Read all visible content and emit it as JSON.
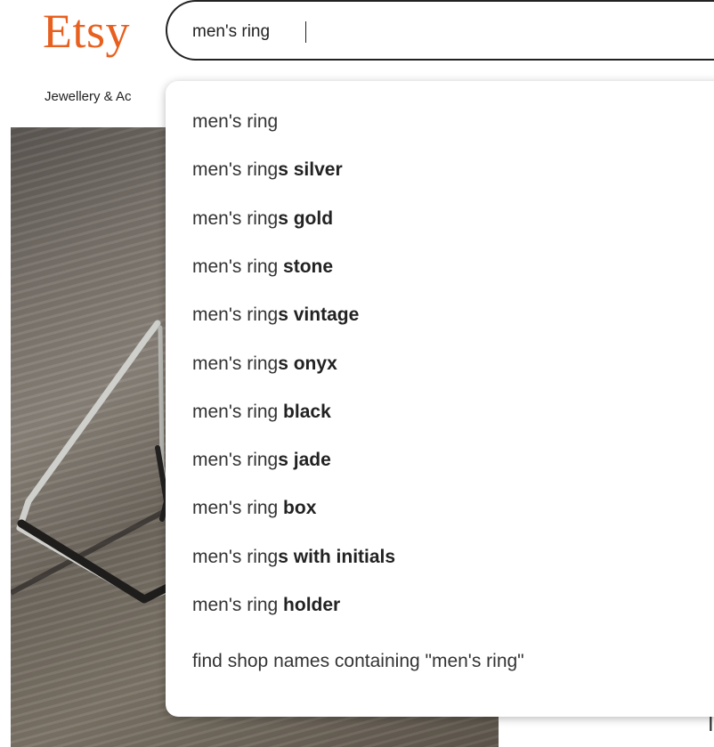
{
  "brand": {
    "logo_text": "Etsy",
    "logo_color": "#e8601f"
  },
  "search": {
    "value": "men's ring"
  },
  "category_nav": {
    "first_item_visible": "Jewellery & Ac"
  },
  "suggestions": [
    {
      "base": "men's ring",
      "suffix": ""
    },
    {
      "base": "men's ring",
      "suffix": "s silver"
    },
    {
      "base": "men's ring",
      "suffix": "s gold"
    },
    {
      "base": "men's ring",
      "suffix": " stone"
    },
    {
      "base": "men's ring",
      "suffix": "s vintage"
    },
    {
      "base": "men's ring",
      "suffix": "s onyx"
    },
    {
      "base": "men's ring",
      "suffix": " black"
    },
    {
      "base": "men's ring",
      "suffix": "s jade"
    },
    {
      "base": "men's ring",
      "suffix": " box"
    },
    {
      "base": "men's ring",
      "suffix": "s with initials"
    },
    {
      "base": "men's ring",
      "suffix": " holder"
    }
  ],
  "shop_search": {
    "label": "find shop names containing \"men's ring\""
  },
  "partial_right_text": "I"
}
